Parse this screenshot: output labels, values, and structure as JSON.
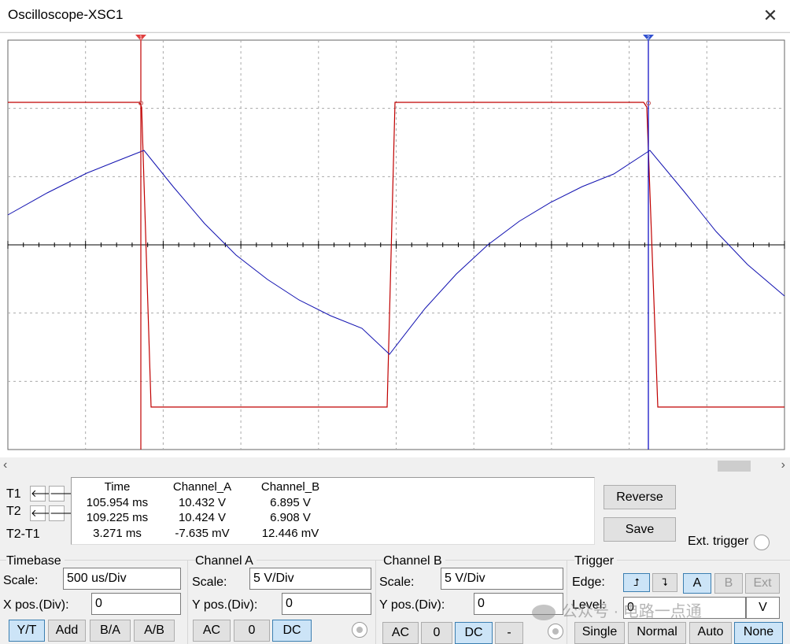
{
  "window": {
    "title": "Oscilloscope-XSC1",
    "close_glyph": "✕"
  },
  "cursors": {
    "t1_marker": "1",
    "t2_marker": "2"
  },
  "readout": {
    "headers": [
      "Time",
      "Channel_A",
      "Channel_B"
    ],
    "rows": [
      {
        "label": "T1",
        "time": "105.954 ms",
        "a": "10.432 V",
        "b": "6.895 V"
      },
      {
        "label": "T2",
        "time": "109.225 ms",
        "a": "10.424 V",
        "b": "6.908 V"
      },
      {
        "label": "T2-T1",
        "time": "3.271 ms",
        "a": "-7.635 mV",
        "b": "12.446 mV"
      }
    ]
  },
  "buttons": {
    "reverse": "Reverse",
    "save": "Save",
    "ext_trigger": "Ext. trigger"
  },
  "timebase": {
    "title": "Timebase",
    "scale_label": "Scale:",
    "scale_value": "500 us/Div",
    "xpos_label": "X pos.(Div):",
    "xpos_value": "0",
    "modes": [
      "Y/T",
      "Add",
      "B/A",
      "A/B"
    ],
    "selected_mode": "Y/T"
  },
  "channel_a": {
    "title": "Channel A",
    "scale_label": "Scale:",
    "scale_value": "5  V/Div",
    "ypos_label": "Y pos.(Div):",
    "ypos_value": "0",
    "coupling": [
      "AC",
      "0",
      "DC"
    ],
    "selected": "DC"
  },
  "channel_b": {
    "title": "Channel B",
    "scale_label": "Scale:",
    "scale_value": "5  V/Div",
    "ypos_label": "Y pos.(Div):",
    "ypos_value": "0",
    "coupling": [
      "AC",
      "0",
      "DC",
      "-"
    ],
    "selected": "DC"
  },
  "trigger": {
    "title": "Trigger",
    "edge_label": "Edge:",
    "level_label": "Level:",
    "level_value": "0",
    "level_unit": "V",
    "sources": [
      "A",
      "B",
      "Ext"
    ],
    "selected_source": "A",
    "modes": [
      "Single",
      "Normal",
      "Auto",
      "None"
    ],
    "selected_mode": "None"
  },
  "watermark": "公众号 · 电路一点通",
  "colors": {
    "channel_a": "#c00000",
    "channel_b": "#0000c0",
    "cursor1": "#c00000",
    "cursor2": "#0000c0"
  }
}
